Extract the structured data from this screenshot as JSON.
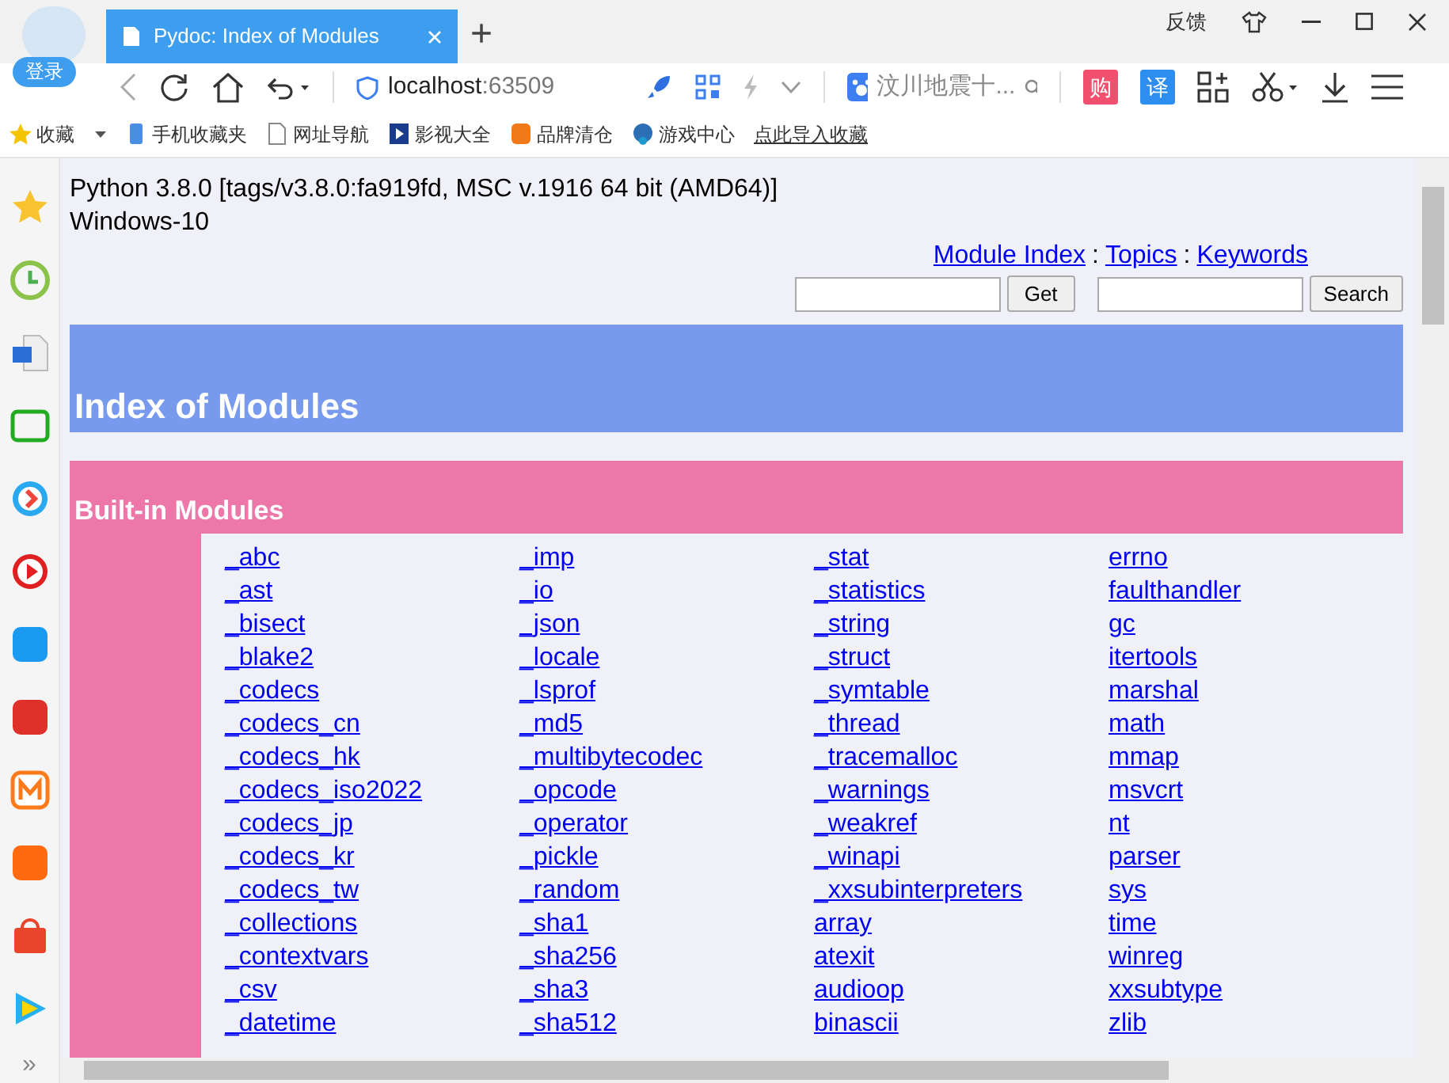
{
  "browser": {
    "login": "登录",
    "tab_title": "Pydoc: Index of Modules",
    "new_tab": "+",
    "feedback": "反馈",
    "address_host": "localhost",
    "address_port": ":63509",
    "search_text": "汶川地震十...",
    "shop_button": "购",
    "translate_button": "译"
  },
  "bookmarks": [
    "收藏",
    "手机收藏夹",
    "网址导航",
    "影视大全",
    "品牌清仓",
    "游戏中心",
    "点此导入收藏"
  ],
  "sidebar": {
    "more": "»"
  },
  "page": {
    "version": "Python 3.8.0 [tags/v3.8.0:fa919fd, MSC v.1916 64 bit (AMD64)]",
    "platform": "Windows-10",
    "nav_links": [
      "Module Index",
      "Topics",
      "Keywords"
    ],
    "separator": ":",
    "get_button": "Get",
    "search_button": "Search",
    "title": "Index of Modules",
    "section": "Built-in Modules",
    "columns": [
      [
        "_abc",
        "_ast",
        "_bisect",
        "_blake2",
        "_codecs",
        "_codecs_cn",
        "_codecs_hk",
        "_codecs_iso2022",
        "_codecs_jp",
        "_codecs_kr",
        "_codecs_tw",
        "_collections",
        "_contextvars",
        "_csv",
        "_datetime"
      ],
      [
        "_imp",
        "_io",
        "_json",
        "_locale",
        "_lsprof",
        "_md5",
        "_multibytecodec",
        "_opcode",
        "_operator",
        "_pickle",
        "_random",
        "_sha1",
        "_sha256",
        "_sha3",
        "_sha512"
      ],
      [
        "_stat",
        "_statistics",
        "_string",
        "_struct",
        "_symtable",
        "_thread",
        "_tracemalloc",
        "_warnings",
        "_weakref",
        "_winapi",
        "_xxsubinterpreters",
        "array",
        "atexit",
        "audioop",
        "binascii"
      ],
      [
        "errno",
        "faulthandler",
        "gc",
        "itertools",
        "marshal",
        "math",
        "mmap",
        "msvcrt",
        "nt",
        "parser",
        "sys",
        "time",
        "winreg",
        "xxsubtype",
        "zlib"
      ]
    ]
  }
}
